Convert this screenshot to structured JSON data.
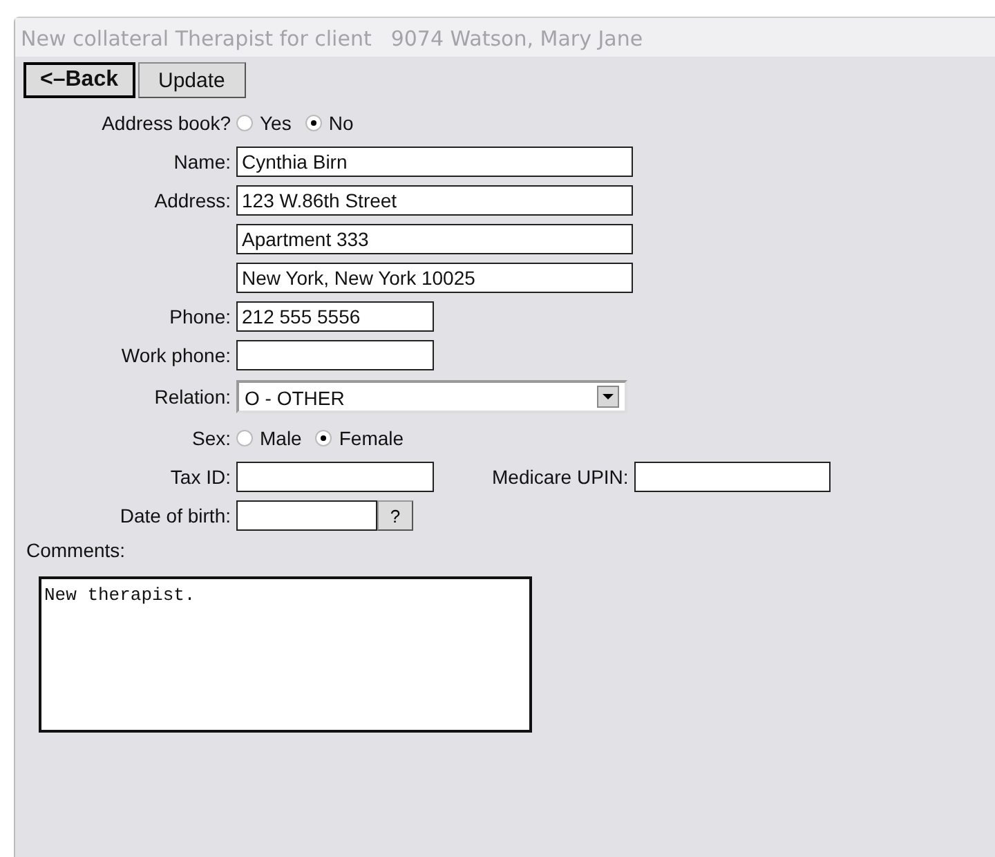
{
  "window": {
    "title": "New collateral Therapist for client",
    "client": "9074 Watson, Mary Jane"
  },
  "buttons": [
    {
      "label": "<–Back",
      "default": true
    },
    {
      "label": "Update",
      "default": false
    }
  ],
  "address_book": {
    "label": "Address book?",
    "options": [
      {
        "label": "Yes",
        "selected": false
      },
      {
        "label": "No",
        "selected": true
      }
    ]
  },
  "name": {
    "label": "Name:",
    "value": "Cynthia Birn"
  },
  "address": {
    "label": "Address:",
    "lines": [
      "123 W.86th Street",
      "Apartment 333",
      "New York, New York 10025"
    ]
  },
  "phone": {
    "label": "Phone:",
    "value": "212 555 5556"
  },
  "work_phone": {
    "label": "Work phone:"
  },
  "relation": {
    "label": "Relation:",
    "value": "O - OTHER"
  },
  "sex": {
    "label": "Sex:",
    "options": [
      {
        "label": "Male",
        "selected": false
      },
      {
        "label": "Female",
        "selected": true
      }
    ]
  },
  "tax_id": {
    "label": "Tax ID:"
  },
  "medicare_upin": {
    "label": "Medicare UPIN:"
  },
  "date_of_birth": {
    "label": "Date of birth:",
    "button": "?"
  },
  "comments": {
    "label": "Comments:",
    "value": "New therapist."
  }
}
